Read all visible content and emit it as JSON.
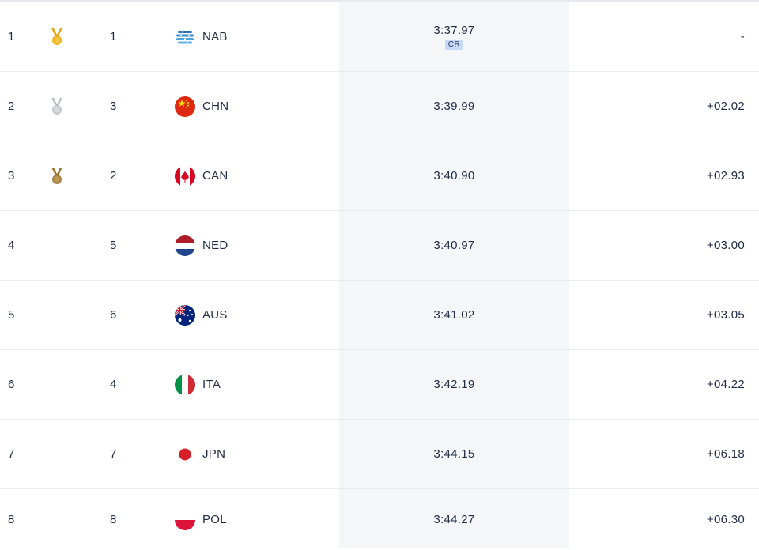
{
  "results": {
    "rows": [
      {
        "rank": "1",
        "medal": "gold-medal-icon",
        "lane": "1",
        "team": "NAB",
        "flag": "nab-logo-icon",
        "time": "3:37.97",
        "record": "CR",
        "diff": "-"
      },
      {
        "rank": "2",
        "medal": "silver-medal-icon",
        "lane": "3",
        "team": "CHN",
        "flag": "china-flag-icon",
        "time": "3:39.99",
        "record": "",
        "diff": "+02.02"
      },
      {
        "rank": "3",
        "medal": "bronze-medal-icon",
        "lane": "2",
        "team": "CAN",
        "flag": "canada-flag-icon",
        "time": "3:40.90",
        "record": "",
        "diff": "+02.93"
      },
      {
        "rank": "4",
        "medal": "",
        "lane": "5",
        "team": "NED",
        "flag": "netherlands-flag-icon",
        "time": "3:40.97",
        "record": "",
        "diff": "+03.00"
      },
      {
        "rank": "5",
        "medal": "",
        "lane": "6",
        "team": "AUS",
        "flag": "australia-flag-icon",
        "time": "3:41.02",
        "record": "",
        "diff": "+03.05"
      },
      {
        "rank": "6",
        "medal": "",
        "lane": "4",
        "team": "ITA",
        "flag": "italy-flag-icon",
        "time": "3:42.19",
        "record": "",
        "diff": "+04.22"
      },
      {
        "rank": "7",
        "medal": "",
        "lane": "7",
        "team": "JPN",
        "flag": "japan-flag-icon",
        "time": "3:44.15",
        "record": "",
        "diff": "+06.18"
      },
      {
        "rank": "8",
        "medal": "",
        "lane": "8",
        "team": "POL",
        "flag": "poland-flag-icon",
        "time": "3:44.27",
        "record": "",
        "diff": "+06.30"
      }
    ]
  },
  "colors": {
    "gold": "#f0b41c",
    "silver": "#c6c8cc",
    "bronze": "#a88443",
    "text": "#1f2a44",
    "time_column_bg": "#f5f6f8",
    "record_badge_bg": "#c8d8f5"
  }
}
